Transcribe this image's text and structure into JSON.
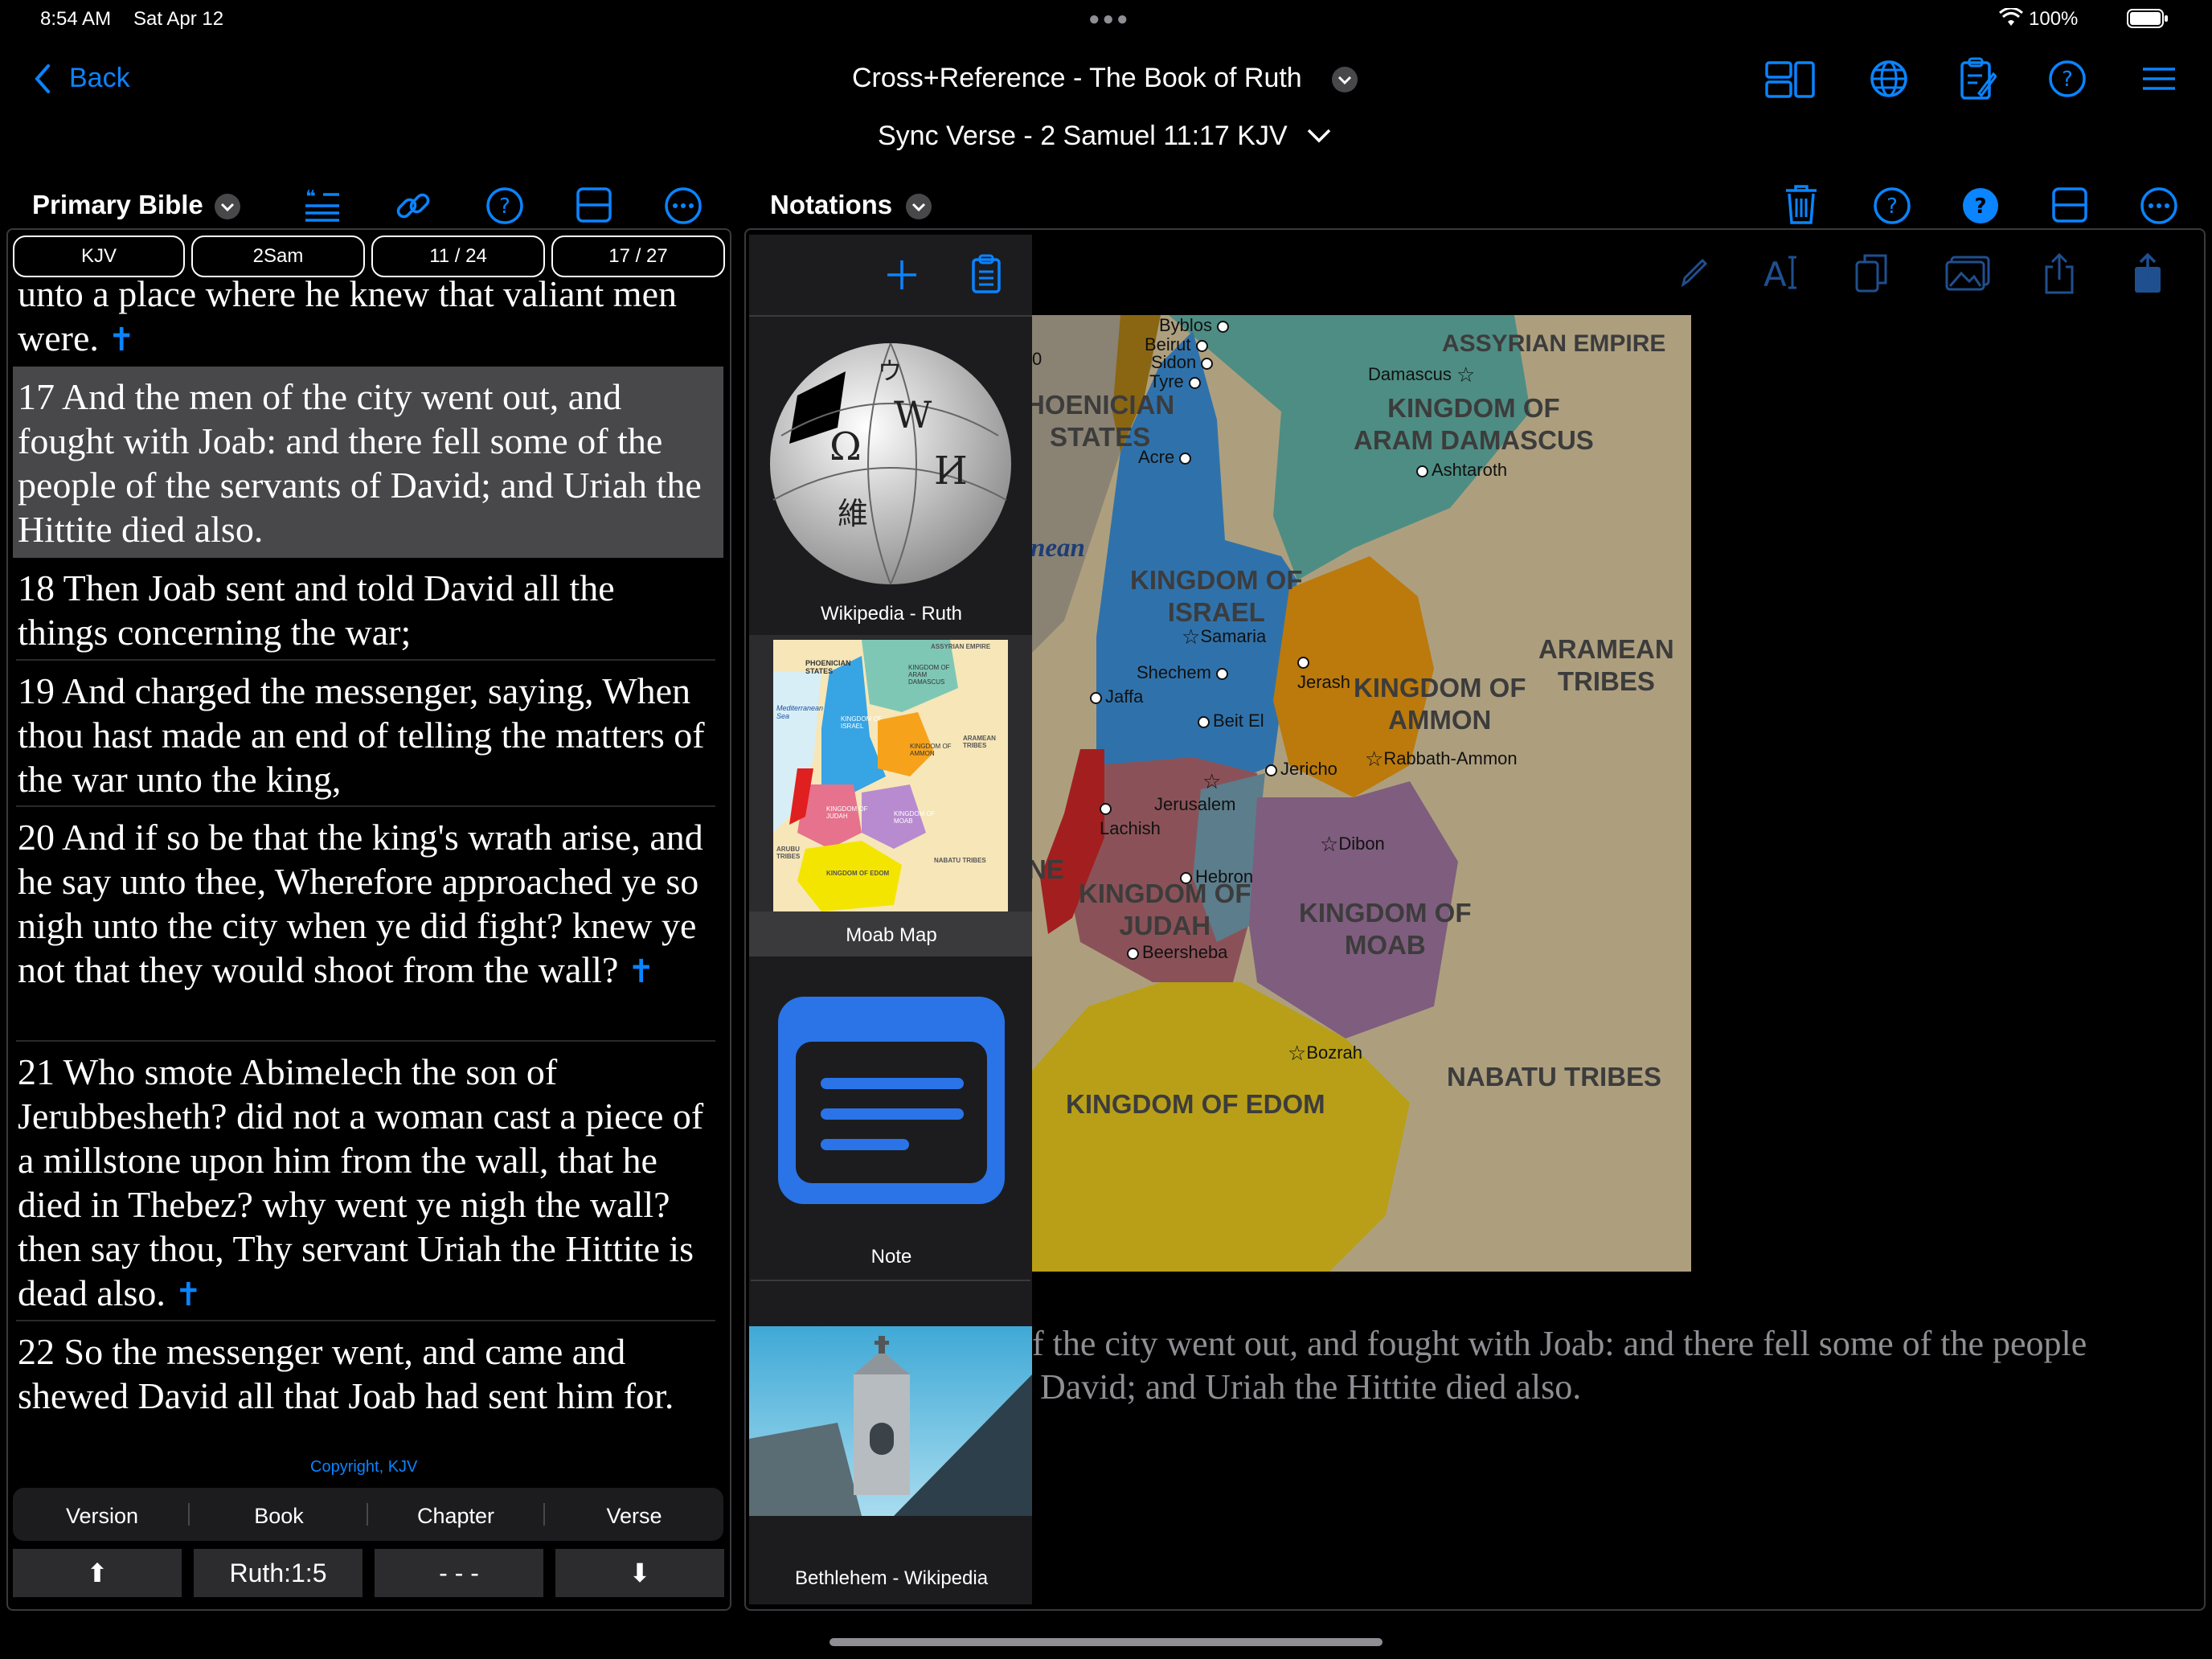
{
  "status_bar": {
    "time": "8:54 AM",
    "date": "Sat Apr 12",
    "battery": "100%"
  },
  "nav": {
    "back_label": "Back",
    "title": "Cross+Reference - The Book of Ruth",
    "sync_label": "Sync Verse - 2 Samuel 11:17 KJV"
  },
  "left_panel": {
    "title": "Primary Bible",
    "pills": [
      "KJV",
      "2Sam",
      "11 / 24",
      "17 / 27"
    ],
    "verses": [
      {
        "text": "unto a place where he knew that valiant men were.",
        "cross": "✝"
      },
      {
        "text": "17 And the men of the city went out, and fought with Joab: and there fell some of the people of the servants of David; and Uriah the Hittite died also.",
        "cross": ""
      },
      {
        "text": "18 Then Joab sent and told David all the things concerning the war;",
        "cross": ""
      },
      {
        "text": "19 And charged the messenger, saying, When thou hast made an end of telling the matters of the war unto the king,",
        "cross": ""
      },
      {
        "text": "20 And if so be that the king's wrath arise, and he say unto thee, Wherefore approached ye so nigh unto the city when ye did fight? knew ye not that they would shoot from the wall?",
        "cross": "✝"
      },
      {
        "text": "21 Who smote Abimelech the son of Jerubbesheth? did not a woman cast a piece of a millstone upon him from the wall, that he died in Thebez? why went ye nigh the wall? then say thou, Thy servant Uriah the Hittite is dead also.",
        "cross": "✝"
      },
      {
        "text": "22 So the messenger went, and came and shewed David all that Joab had sent him for.",
        "cross": ""
      }
    ],
    "copyright": "Copyright, KJV",
    "nav_tabs": [
      "Version",
      "Book",
      "Chapter",
      "Verse"
    ],
    "buttons": {
      "up": "⬆",
      "location": "Ruth:1:5",
      "middle": "- - -",
      "down": "⬇"
    }
  },
  "right_panel": {
    "title": "Notations",
    "thumbnails": [
      {
        "label": "Wikipedia - Ruth"
      },
      {
        "label": "Moab Map"
      },
      {
        "label": "Note"
      },
      {
        "label": "Bethlehem - Wikipedia"
      }
    ],
    "thumb_map_labels": [
      "PHOENICIAN STATES",
      "ASSYRIAN EMPIRE",
      "KINGDOM OF ARAM DAMASCUS",
      "Mediterranean Sea",
      "KINGDOM OF ISRAEL",
      "KINGDOM OF AMMON",
      "ARAMEAN TRIBES",
      "KINGDOM OF JUDAH",
      "KINGDOM OF MOAB",
      "ARUBU TRIBES",
      "KINGDOM OF EDOM",
      "NABATU TRIBES"
    ],
    "wiki_glyphs": [
      "Ω",
      "W",
      "И",
      "維",
      "ウ"
    ],
    "map": {
      "regions": [
        "HOENICIAN\nSTATES",
        "ASSYRIAN EMPIRE",
        "KINGDOM OF\nARAM DAMASCUS",
        "KINGDOM OF\nISRAEL",
        "KINGDOM OF\nAMMON",
        "ARAMEAN\nTRIBES",
        "KINGDOM OF\nJUDAH",
        "KINGDOM OF\nMOAB",
        "KINGDOM OF EDOM",
        "NABATU TRIBES",
        "nean",
        "NE"
      ],
      "cities": [
        "Byblos",
        "Beirut",
        "Sidon",
        "Tyre",
        "Acre",
        "Damascus",
        "Ashtaroth",
        "Samaria",
        "Shechem",
        "Jerash",
        "Jaffa",
        "Beit El",
        "Jericho",
        "Rabbath-Ammon",
        "Jerusalem",
        "Lachish",
        "Dibon",
        "Hebron",
        "Beersheba",
        "Bozrah",
        "0"
      ]
    },
    "overlay_text": {
      "line1": "f the city went out, and fought with Joab: and there fell some of the people",
      "line2": "David; and Uriah the Hittite died also."
    }
  },
  "colors": {
    "accent": "#0a84ff",
    "highlight": "#48484a",
    "panel_border": "#3a3a3c"
  }
}
